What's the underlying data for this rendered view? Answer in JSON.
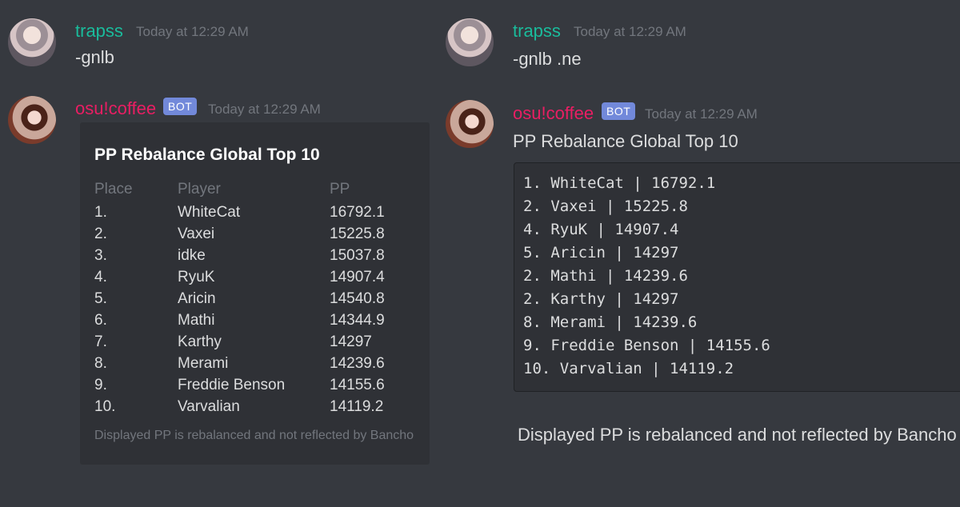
{
  "left": {
    "user_message": {
      "username": "trapss",
      "timestamp": "Today at 12:29 AM",
      "text": "-gnlb"
    },
    "bot_message": {
      "username": "osu!coffee",
      "bot_tag": "BOT",
      "timestamp": "Today at 12:29 AM",
      "embed": {
        "title": "PP Rebalance Global Top 10",
        "columns": {
          "place": "Place",
          "player": "Player",
          "pp": "PP"
        },
        "rows": [
          {
            "place": "1.",
            "player": "WhiteCat",
            "pp": "16792.1"
          },
          {
            "place": "2.",
            "player": "Vaxei",
            "pp": "15225.8"
          },
          {
            "place": "3.",
            "player": "idke",
            "pp": "15037.8"
          },
          {
            "place": "4.",
            "player": "RyuK",
            "pp": "14907.4"
          },
          {
            "place": "5.",
            "player": "Aricin",
            "pp": "14540.8"
          },
          {
            "place": "6.",
            "player": "Mathi",
            "pp": "14344.9"
          },
          {
            "place": "7.",
            "player": "Karthy",
            "pp": "14297"
          },
          {
            "place": "8.",
            "player": "Merami",
            "pp": "14239.6"
          },
          {
            "place": "9.",
            "player": "Freddie Benson",
            "pp": "14155.6"
          },
          {
            "place": "10.",
            "player": "Varvalian",
            "pp": "14119.2"
          }
        ],
        "footer": "Displayed PP is rebalanced and not reflected by Bancho"
      }
    }
  },
  "right": {
    "user_message": {
      "username": "trapss",
      "timestamp": "Today at 12:29 AM",
      "text": "-gnlb .ne"
    },
    "bot_message": {
      "username": "osu!coffee",
      "bot_tag": "BOT",
      "timestamp": "Today at 12:29 AM",
      "text": "PP Rebalance Global Top 10",
      "code_lines": [
        "1. WhiteCat | 16792.1",
        "2. Vaxei | 15225.8",
        "4. RyuK | 14907.4",
        "5. Aricin | 14297",
        "2. Mathi | 14239.6",
        "2. Karthy | 14297",
        "8. Merami | 14239.6",
        "9. Freddie Benson | 14155.6",
        "10. Varvalian | 14119.2"
      ],
      "footer": "Displayed PP is rebalanced and not reflected by Bancho"
    }
  },
  "colors": {
    "background": "#36393f",
    "embed_background": "#2f3136",
    "trapss_name": "#1abc9c",
    "coffee_name": "#e91e63",
    "bot_tag": "#7289da",
    "muted": "#72767d"
  }
}
